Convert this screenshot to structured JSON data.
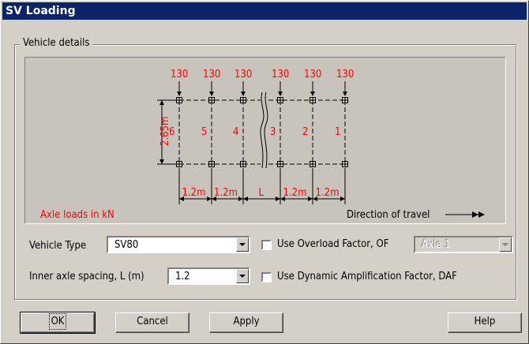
{
  "window": {
    "title": "SV Loading"
  },
  "vehicle_details": {
    "legend": "Vehicle details",
    "diagram": {
      "axle_loads": [
        "130",
        "130",
        "130",
        "130",
        "130",
        "130"
      ],
      "axle_numbers": [
        "6",
        "5",
        "4",
        "3",
        "2",
        "1"
      ],
      "height_label": "2.65m",
      "spacing_labels": [
        "1.2m",
        "1.2m",
        "L",
        "1.2m",
        "1.2m"
      ],
      "units_note": "Axle loads in kN",
      "direction_label": "Direction of travel"
    }
  },
  "form": {
    "vehicle_type_label": "Vehicle Type",
    "vehicle_type_value": "SV80",
    "inner_axle_label": "Inner axle spacing, L (m)",
    "inner_axle_value": "1.2",
    "overload_label": "Use Overload Factor, OF",
    "overload_checked": false,
    "axle_select_value": "Axle 1",
    "daf_label": "Use Dynamic Amplification Factor, DAF",
    "daf_checked": false
  },
  "buttons": {
    "ok": "OK",
    "cancel": "Cancel",
    "apply": "Apply",
    "help": "Help"
  },
  "colors": {
    "title_bar": "#0a246a",
    "accent_red": "#ff0000",
    "face": "#d4d0c8"
  }
}
